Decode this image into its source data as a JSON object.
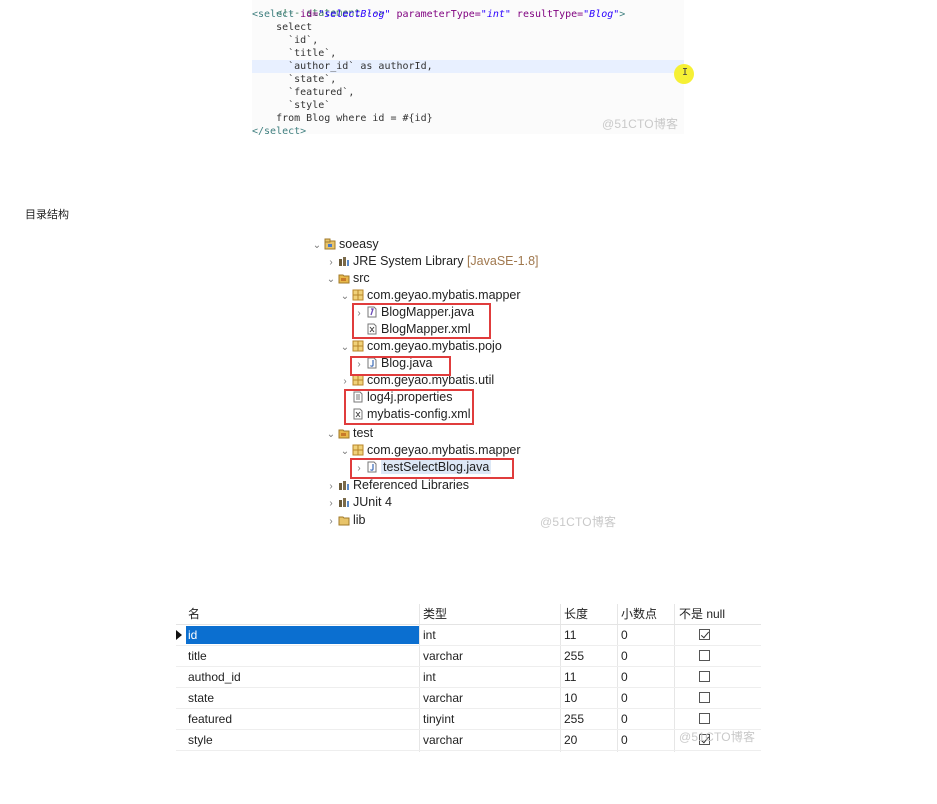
{
  "code": {
    "comment": "<!-- statement -->",
    "select_open": {
      "tag_start": "<select ",
      "id_attr": "id=",
      "id_val": "\"selectBlog\"",
      "param_attr": " parameterType=",
      "param_val": "\"int\"",
      "result_attr": " resultType=",
      "result_val": "\"Blog\"",
      "tag_end": ">"
    },
    "lines": [
      "    select",
      "      `id`,",
      "      `title`,",
      "      `author_id` as authorId,",
      "      `state`,",
      "      `featured`,",
      "      `style`",
      "    from Blog where id = #{id}"
    ],
    "select_close": "</select>",
    "cursor_mark": "I",
    "watermark": "@51CTO博客"
  },
  "section_label": "目录结构",
  "tree": {
    "rows": [
      {
        "label": "soeasy",
        "arrow": "⌄",
        "icon": "project-icon"
      },
      {
        "label": "JRE System Library",
        "suffix": "[JavaSE-1.8]",
        "arrow": "›",
        "icon": "library-icon"
      },
      {
        "label": "src",
        "arrow": "⌄",
        "icon": "source-folder-icon"
      },
      {
        "label": "com.geyao.mybatis.mapper",
        "arrow": "⌄",
        "icon": "package-icon"
      },
      {
        "label": "BlogMapper.java",
        "arrow": "›",
        "icon": "java-interface-icon"
      },
      {
        "label": "BlogMapper.xml",
        "arrow": "",
        "icon": "xml-file-icon"
      },
      {
        "label": "com.geyao.mybatis.pojo",
        "arrow": "⌄",
        "icon": "package-icon"
      },
      {
        "label": "Blog.java",
        "arrow": "›",
        "icon": "java-file-icon"
      },
      {
        "label": "com.geyao.mybatis.util",
        "arrow": "›",
        "icon": "package-icon"
      },
      {
        "label": "log4j.properties",
        "arrow": "",
        "icon": "properties-file-icon"
      },
      {
        "label": "mybatis-config.xml",
        "arrow": "",
        "icon": "xml-file-icon"
      },
      {
        "label": "test",
        "arrow": "⌄",
        "icon": "source-folder-icon"
      },
      {
        "label": "com.geyao.mybatis.mapper",
        "arrow": "⌄",
        "icon": "package-icon"
      },
      {
        "label": "testSelectBlog.java",
        "arrow": "›",
        "icon": "java-file-icon"
      },
      {
        "label": "Referenced Libraries",
        "arrow": "›",
        "icon": "library-icon"
      },
      {
        "label": "JUnit 4",
        "arrow": "›",
        "icon": "library-icon"
      },
      {
        "label": "lib",
        "arrow": "›",
        "icon": "folder-icon"
      }
    ],
    "watermark": "@51CTO博客"
  },
  "table": {
    "headers": [
      "名",
      "类型",
      "长度",
      "小数点",
      "不是 null"
    ],
    "rows": [
      {
        "name": "id",
        "type": "int",
        "length": "11",
        "decimals": "0",
        "not_null": true
      },
      {
        "name": "title",
        "type": "varchar",
        "length": "255",
        "decimals": "0",
        "not_null": false
      },
      {
        "name": "authod_id",
        "type": "int",
        "length": "11",
        "decimals": "0",
        "not_null": false
      },
      {
        "name": "state",
        "type": "varchar",
        "length": "10",
        "decimals": "0",
        "not_null": false
      },
      {
        "name": "featured",
        "type": "tinyint",
        "length": "255",
        "decimals": "0",
        "not_null": false
      },
      {
        "name": "style",
        "type": "varchar",
        "length": "20",
        "decimals": "0",
        "not_null": true
      }
    ],
    "watermark": "@51CTO博客"
  }
}
